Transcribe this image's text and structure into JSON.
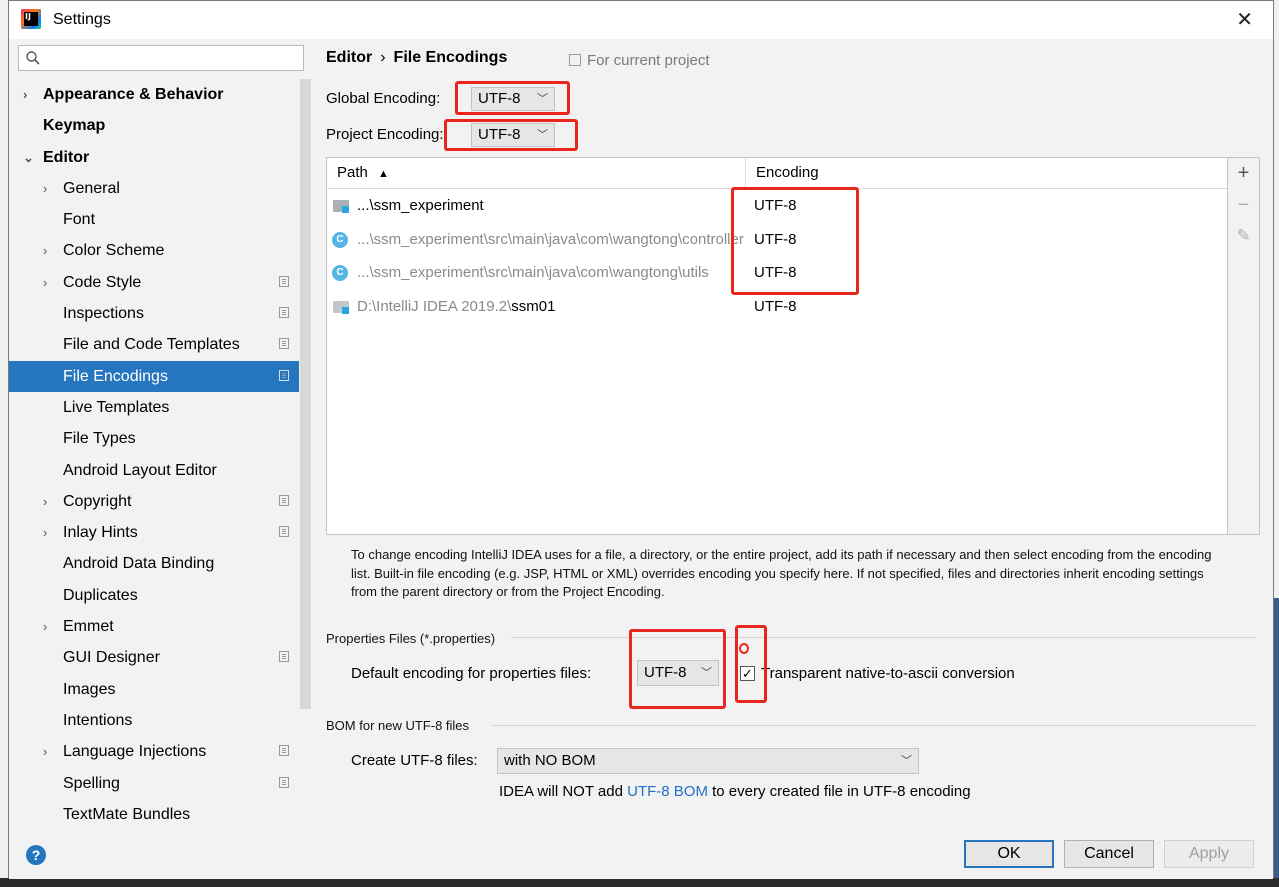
{
  "window": {
    "title": "Settings"
  },
  "sidebar": {
    "items": [
      {
        "label": "Appearance & Behavior",
        "bold": true,
        "arrow": "›",
        "level": 0,
        "project": false
      },
      {
        "label": "Keymap",
        "bold": true,
        "arrow": "",
        "level": 0,
        "project": false
      },
      {
        "label": "Editor",
        "bold": true,
        "arrow": "⌄",
        "level": 0,
        "project": false
      },
      {
        "label": "General",
        "bold": false,
        "arrow": "›",
        "level": 1,
        "project": false
      },
      {
        "label": "Font",
        "bold": false,
        "arrow": "",
        "level": 1,
        "project": false
      },
      {
        "label": "Color Scheme",
        "bold": false,
        "arrow": "›",
        "level": 1,
        "project": false
      },
      {
        "label": "Code Style",
        "bold": false,
        "arrow": "›",
        "level": 1,
        "project": true
      },
      {
        "label": "Inspections",
        "bold": false,
        "arrow": "",
        "level": 1,
        "project": true
      },
      {
        "label": "File and Code Templates",
        "bold": false,
        "arrow": "",
        "level": 1,
        "project": true
      },
      {
        "label": "File Encodings",
        "bold": false,
        "arrow": "",
        "level": 1,
        "project": true,
        "selected": true
      },
      {
        "label": "Live Templates",
        "bold": false,
        "arrow": "",
        "level": 1,
        "project": false
      },
      {
        "label": "File Types",
        "bold": false,
        "arrow": "",
        "level": 1,
        "project": false
      },
      {
        "label": "Android Layout Editor",
        "bold": false,
        "arrow": "",
        "level": 1,
        "project": false
      },
      {
        "label": "Copyright",
        "bold": false,
        "arrow": "›",
        "level": 1,
        "project": true
      },
      {
        "label": "Inlay Hints",
        "bold": false,
        "arrow": "›",
        "level": 1,
        "project": true
      },
      {
        "label": "Android Data Binding",
        "bold": false,
        "arrow": "",
        "level": 1,
        "project": false
      },
      {
        "label": "Duplicates",
        "bold": false,
        "arrow": "",
        "level": 1,
        "project": false
      },
      {
        "label": "Emmet",
        "bold": false,
        "arrow": "›",
        "level": 1,
        "project": false
      },
      {
        "label": "GUI Designer",
        "bold": false,
        "arrow": "",
        "level": 1,
        "project": true
      },
      {
        "label": "Images",
        "bold": false,
        "arrow": "",
        "level": 1,
        "project": false
      },
      {
        "label": "Intentions",
        "bold": false,
        "arrow": "",
        "level": 1,
        "project": false
      },
      {
        "label": "Language Injections",
        "bold": false,
        "arrow": "›",
        "level": 1,
        "project": true
      },
      {
        "label": "Spelling",
        "bold": false,
        "arrow": "",
        "level": 1,
        "project": true
      },
      {
        "label": "TextMate Bundles",
        "bold": false,
        "arrow": "",
        "level": 1,
        "project": false
      }
    ]
  },
  "breadcrumb": {
    "parent": "Editor",
    "separator": "›",
    "current": "File Encodings"
  },
  "for_project": "For current project",
  "global_encoding": {
    "label": "Global Encoding:",
    "value": "UTF-8"
  },
  "project_encoding": {
    "label": "Project Encoding:",
    "value": "UTF-8"
  },
  "table": {
    "headers": {
      "path": "Path",
      "sort": "▲",
      "encoding": "Encoding"
    },
    "rows": [
      {
        "icon": "folder",
        "path_prefix": "...\\",
        "path_main": "ssm_experiment",
        "grey": false,
        "encoding": "UTF-8"
      },
      {
        "icon": "class",
        "path_prefix": "...\\ssm_experiment\\src\\main\\java\\com\\wangtong\\controller",
        "path_main": "",
        "grey": true,
        "encoding": "UTF-8"
      },
      {
        "icon": "class",
        "path_prefix": "...\\ssm_experiment\\src\\main\\java\\com\\wangtong\\utils",
        "path_main": "",
        "grey": true,
        "encoding": "UTF-8"
      },
      {
        "icon": "folder-grey",
        "path_prefix": "D:\\IntelliJ IDEA 2019.2\\",
        "path_main": "ssm01",
        "grey": true,
        "encoding": "UTF-8"
      }
    ]
  },
  "tools": {
    "add": "+",
    "remove": "−",
    "edit": "✎"
  },
  "hint": "To change encoding IntelliJ IDEA uses for a file, a directory, or the entire project, add its path if necessary and then select encoding from the encoding list. Built-in file encoding (e.g. JSP, HTML or XML) overrides encoding you specify here. If not specified, files and directories inherit encoding settings from the parent directory or from the Project Encoding.",
  "properties": {
    "section": "Properties Files (*.properties)",
    "default_label": "Default encoding for properties files:",
    "default_value": "UTF-8",
    "transparent_label": "Transparent native-to-ascii conversion",
    "transparent_checked": "✓"
  },
  "bom": {
    "section": "BOM for new UTF-8 files",
    "create_label": "Create UTF-8 files:",
    "create_value": "with NO BOM",
    "note_before": "IDEA will NOT add ",
    "note_link": "UTF-8 BOM",
    "note_after": " to every created file in UTF-8 encoding"
  },
  "footer": {
    "help": "?",
    "ok": "OK",
    "cancel": "Cancel",
    "apply": "Apply"
  },
  "colors": {
    "selection": "#2675bf",
    "highlight": "#e8261d",
    "link": "#2470c4"
  }
}
